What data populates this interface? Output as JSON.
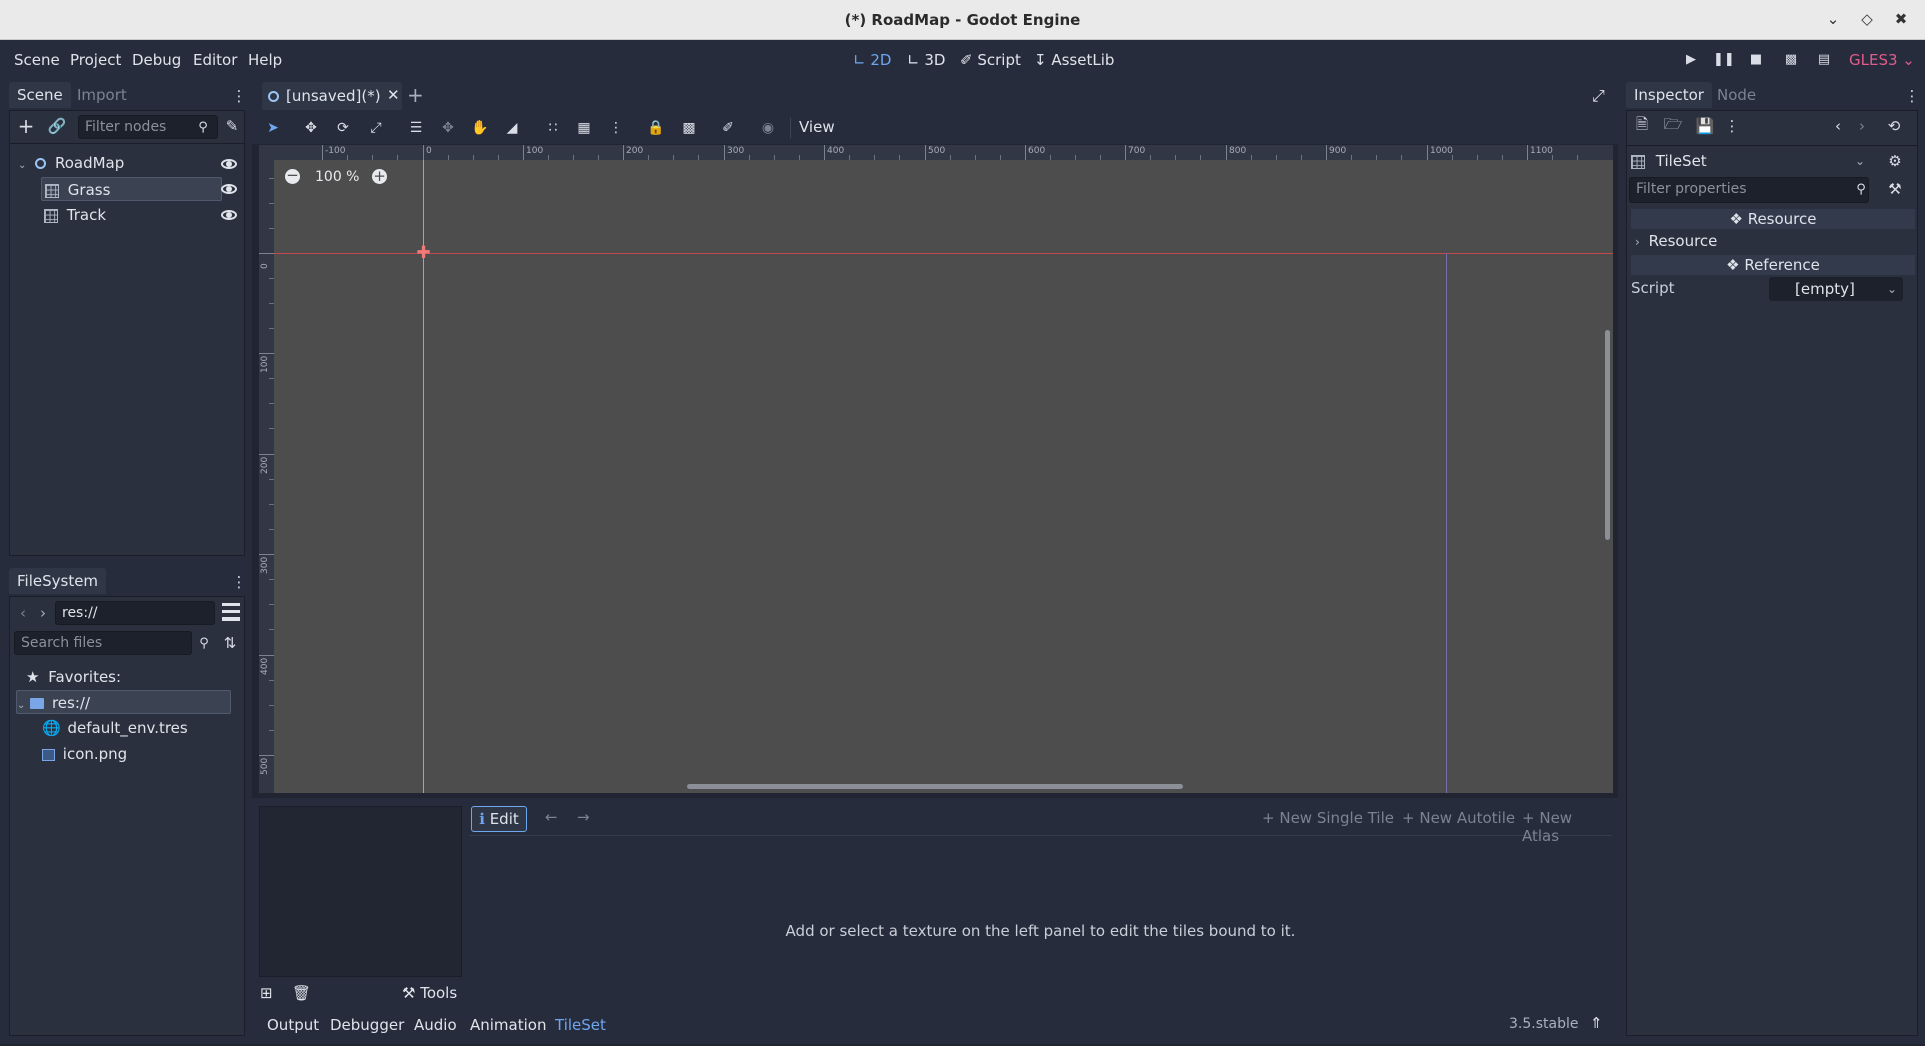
{
  "window": {
    "title": "(*) RoadMap - Godot Engine"
  },
  "menu": {
    "items": [
      "Scene",
      "Project",
      "Debug",
      "Editor",
      "Help"
    ]
  },
  "modes": {
    "d2": "2D",
    "d3": "3D",
    "script": "Script",
    "assetlib": "AssetLib"
  },
  "renderer": "GLES3",
  "scene_dock": {
    "tabs": [
      "Scene",
      "Import"
    ],
    "filter_placeholder": "Filter nodes",
    "tree": [
      {
        "label": "RoadMap",
        "icon": "node2d-icon"
      },
      {
        "label": "Grass",
        "icon": "tilemap-icon"
      },
      {
        "label": "Track",
        "icon": "tilemap-icon"
      }
    ]
  },
  "filesystem": {
    "tab": "FileSystem",
    "path": "res://",
    "search_placeholder": "Search files",
    "items": [
      {
        "label": "Favorites:",
        "icon": "star-icon"
      },
      {
        "label": "res://",
        "icon": "folder-icon"
      },
      {
        "label": "default_env.tres",
        "icon": "environment-icon"
      },
      {
        "label": "icon.png",
        "icon": "image-icon"
      }
    ]
  },
  "editor_tab": {
    "label": "[unsaved](*)"
  },
  "viewport": {
    "zoom": "100 %",
    "view_menu": "View",
    "ruler_top": [
      "-100",
      "0",
      "100",
      "200",
      "300",
      "400",
      "500",
      "600",
      "700",
      "800",
      "900",
      "1000",
      "1100"
    ],
    "ruler_left": [
      "0",
      "100",
      "200",
      "300",
      "400",
      "500"
    ]
  },
  "tileset_editor": {
    "edit": "Edit",
    "new_single_tile": "New Single Tile",
    "new_autotile": "New Autotile",
    "new_atlas": "New Atlas",
    "message": "Add or select a texture on the left panel to edit the tiles bound to it.",
    "tools": "Tools"
  },
  "bottom_panel": {
    "tabs": [
      "Output",
      "Debugger",
      "Audio",
      "Animation",
      "TileSet"
    ],
    "version": "3.5.stable"
  },
  "inspector": {
    "tabs": [
      "Inspector",
      "Node"
    ],
    "resource_type": "TileSet",
    "filter_placeholder": "Filter properties",
    "section_resource": "Resource",
    "group_resource": "Resource",
    "section_reference": "Reference",
    "script_label": "Script",
    "script_value": "[empty]"
  },
  "colors": {
    "accent": "#6ea6f0",
    "renderer": "#e05d8c",
    "viewport_bg": "#4d4d4d"
  }
}
